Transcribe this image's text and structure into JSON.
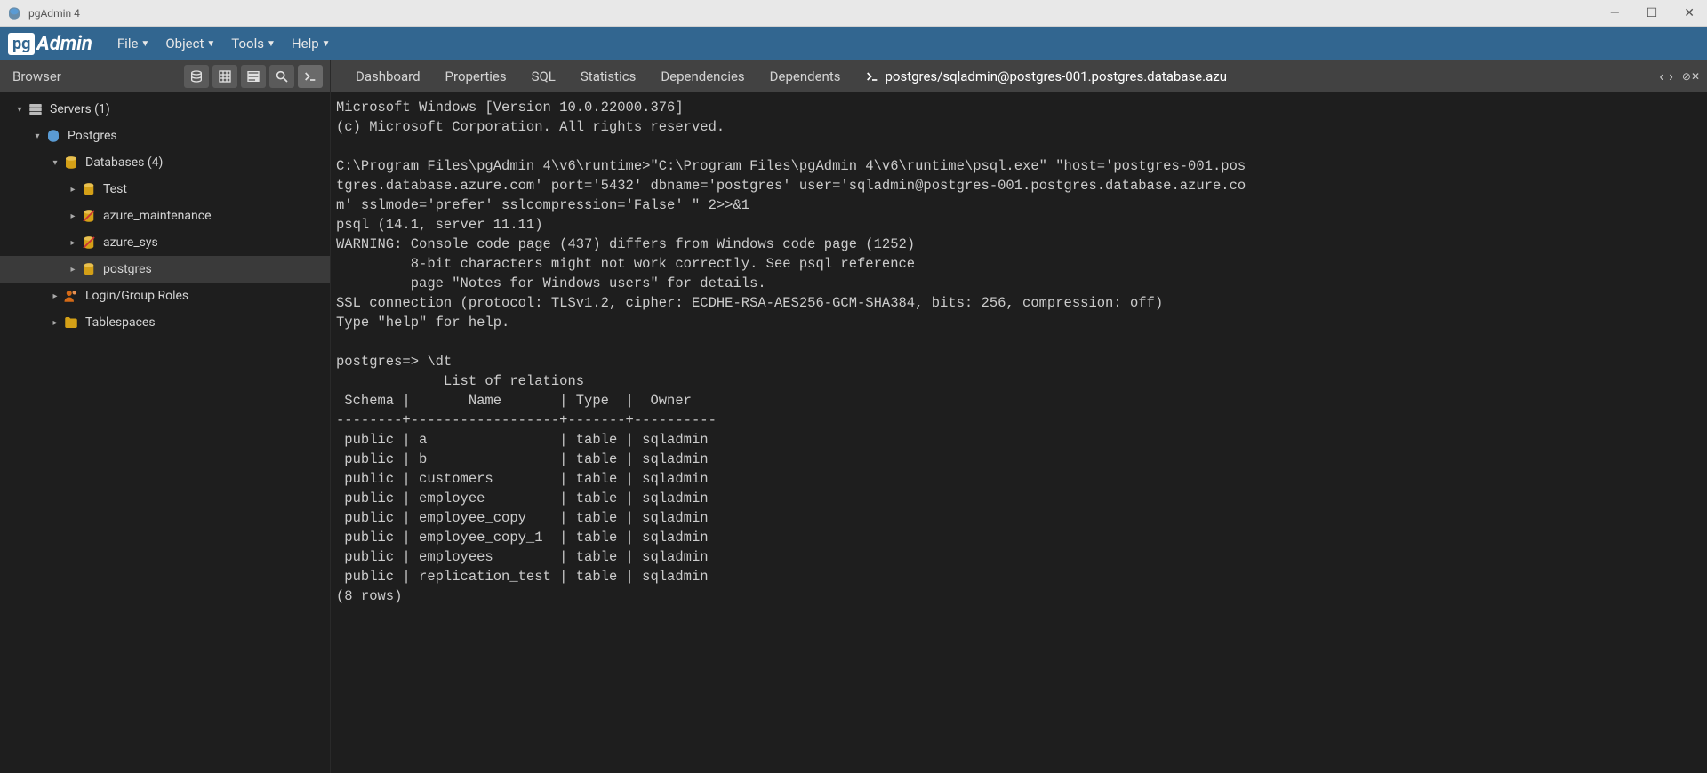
{
  "window": {
    "title": "pgAdmin 4"
  },
  "menubar": {
    "logo_pg": "pg",
    "logo_admin": "Admin",
    "items": [
      "File",
      "Object",
      "Tools",
      "Help"
    ]
  },
  "sidebar": {
    "title": "Browser",
    "tree": {
      "servers_label": "Servers (1)",
      "postgres_group": "Postgres",
      "databases_label": "Databases (4)",
      "db_items": [
        "Test",
        "azure_maintenance",
        "azure_sys",
        "postgres"
      ],
      "login_roles": "Login/Group Roles",
      "tablespaces": "Tablespaces"
    }
  },
  "tabs": {
    "items": [
      "Dashboard",
      "Properties",
      "SQL",
      "Statistics",
      "Dependencies",
      "Dependents"
    ],
    "psql_label": "postgres/sqladmin@postgres-001.postgres.database.azu"
  },
  "terminal": {
    "lines": [
      "Microsoft Windows [Version 10.0.22000.376]",
      "(c) Microsoft Corporation. All rights reserved.",
      "",
      "C:\\Program Files\\pgAdmin 4\\v6\\runtime>\"C:\\Program Files\\pgAdmin 4\\v6\\runtime\\psql.exe\" \"host='postgres-001.pos",
      "tgres.database.azure.com' port='5432' dbname='postgres' user='sqladmin@postgres-001.postgres.database.azure.co",
      "m' sslmode='prefer' sslcompression='False' \" 2>>&1",
      "psql (14.1, server 11.11)",
      "WARNING: Console code page (437) differs from Windows code page (1252)",
      "         8-bit characters might not work correctly. See psql reference",
      "         page \"Notes for Windows users\" for details.",
      "SSL connection (protocol: TLSv1.2, cipher: ECDHE-RSA-AES256-GCM-SHA384, bits: 256, compression: off)",
      "Type \"help\" for help.",
      "",
      "postgres=> \\dt",
      "             List of relations",
      " Schema |       Name       | Type  |  Owner",
      "--------+------------------+-------+----------",
      " public | a                | table | sqladmin",
      " public | b                | table | sqladmin",
      " public | customers        | table | sqladmin",
      " public | employee         | table | sqladmin",
      " public | employee_copy    | table | sqladmin",
      " public | employee_copy_1  | table | sqladmin",
      " public | employees        | table | sqladmin",
      " public | replication_test | table | sqladmin",
      "(8 rows)"
    ]
  }
}
